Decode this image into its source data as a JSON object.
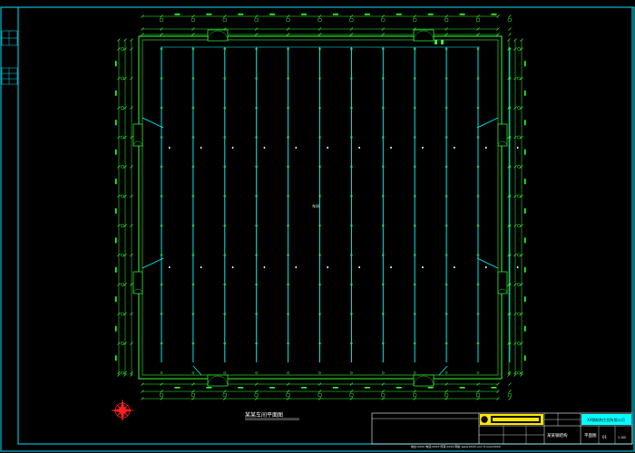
{
  "drawing": {
    "plan_title": "某某车间平面图",
    "center_label": "车间",
    "footer_line": "地址:XXXX  电话:XXXX  传真:XXXX  网址:www.XXXX.com  E-mail:XXXX"
  },
  "title_block": {
    "company": "XX钢结构工程有限公司",
    "project": "某某钢结构",
    "sheet_name": "平面图",
    "sheet_no": "01",
    "scale": "1:100"
  },
  "colors": {
    "border": "#00e5ff",
    "structure": "#33ff33",
    "purlin": "#00ffff",
    "dimension": "#33ff33",
    "text": "#ffffff",
    "north": "#ff2020",
    "title_yellow": "#ffe600"
  },
  "icons": {
    "north_arrow": "compass-rose-icon",
    "door": "door-swing-icon"
  }
}
